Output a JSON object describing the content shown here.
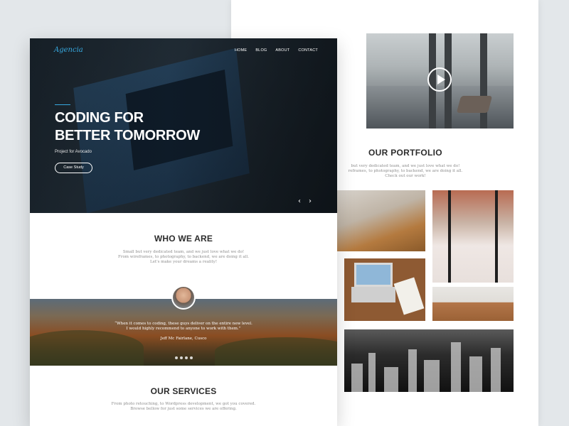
{
  "hero": {
    "logo": "Agencia",
    "nav": [
      "HOME",
      "BLOG",
      "ABOUT",
      "CONTACT"
    ],
    "title_line1": "CODING FOR",
    "title_line2": "BETTER TOMORROW",
    "subtitle": "Project for Avocado",
    "button": "Case Study",
    "prev_icon": "chevron-left-icon",
    "next_icon": "chevron-right-icon"
  },
  "who": {
    "title": "WHO WE ARE",
    "desc_line1": "Small but very dedicated team, and we just love what we do!",
    "desc_line2": "From wireframes, to photography, to backend, we are doing it all.",
    "desc_line3": "Let's make your dreams a reality!"
  },
  "testimonial": {
    "quote_line1": "“When it comes to coding, these guys deliver on the entire new level.",
    "quote_line2": "I would highly recommend to anyone to work with them.”",
    "author": "Jeff Mc Fairlane, Cusco",
    "slide_count": 4
  },
  "services": {
    "title": "OUR SERVICES",
    "desc_line1": "From photo retouching, to Wordpress development, we got you covered.",
    "desc_line2": "Browse bellow for just some services we are offering."
  },
  "portfolio": {
    "title": "OUR PORTFOLIO",
    "desc_line1": "but very dedicated team, and we just love what we do!",
    "desc_line2": "reframes, to photography, to backend, we are doing it all.",
    "desc_line3": "Check out our work!",
    "video_icon": "play-icon"
  },
  "colors": {
    "accent": "#37a9e0",
    "background": "#e3e7ea",
    "heading": "#2c2c2c",
    "body_text": "#8e8e8e"
  }
}
